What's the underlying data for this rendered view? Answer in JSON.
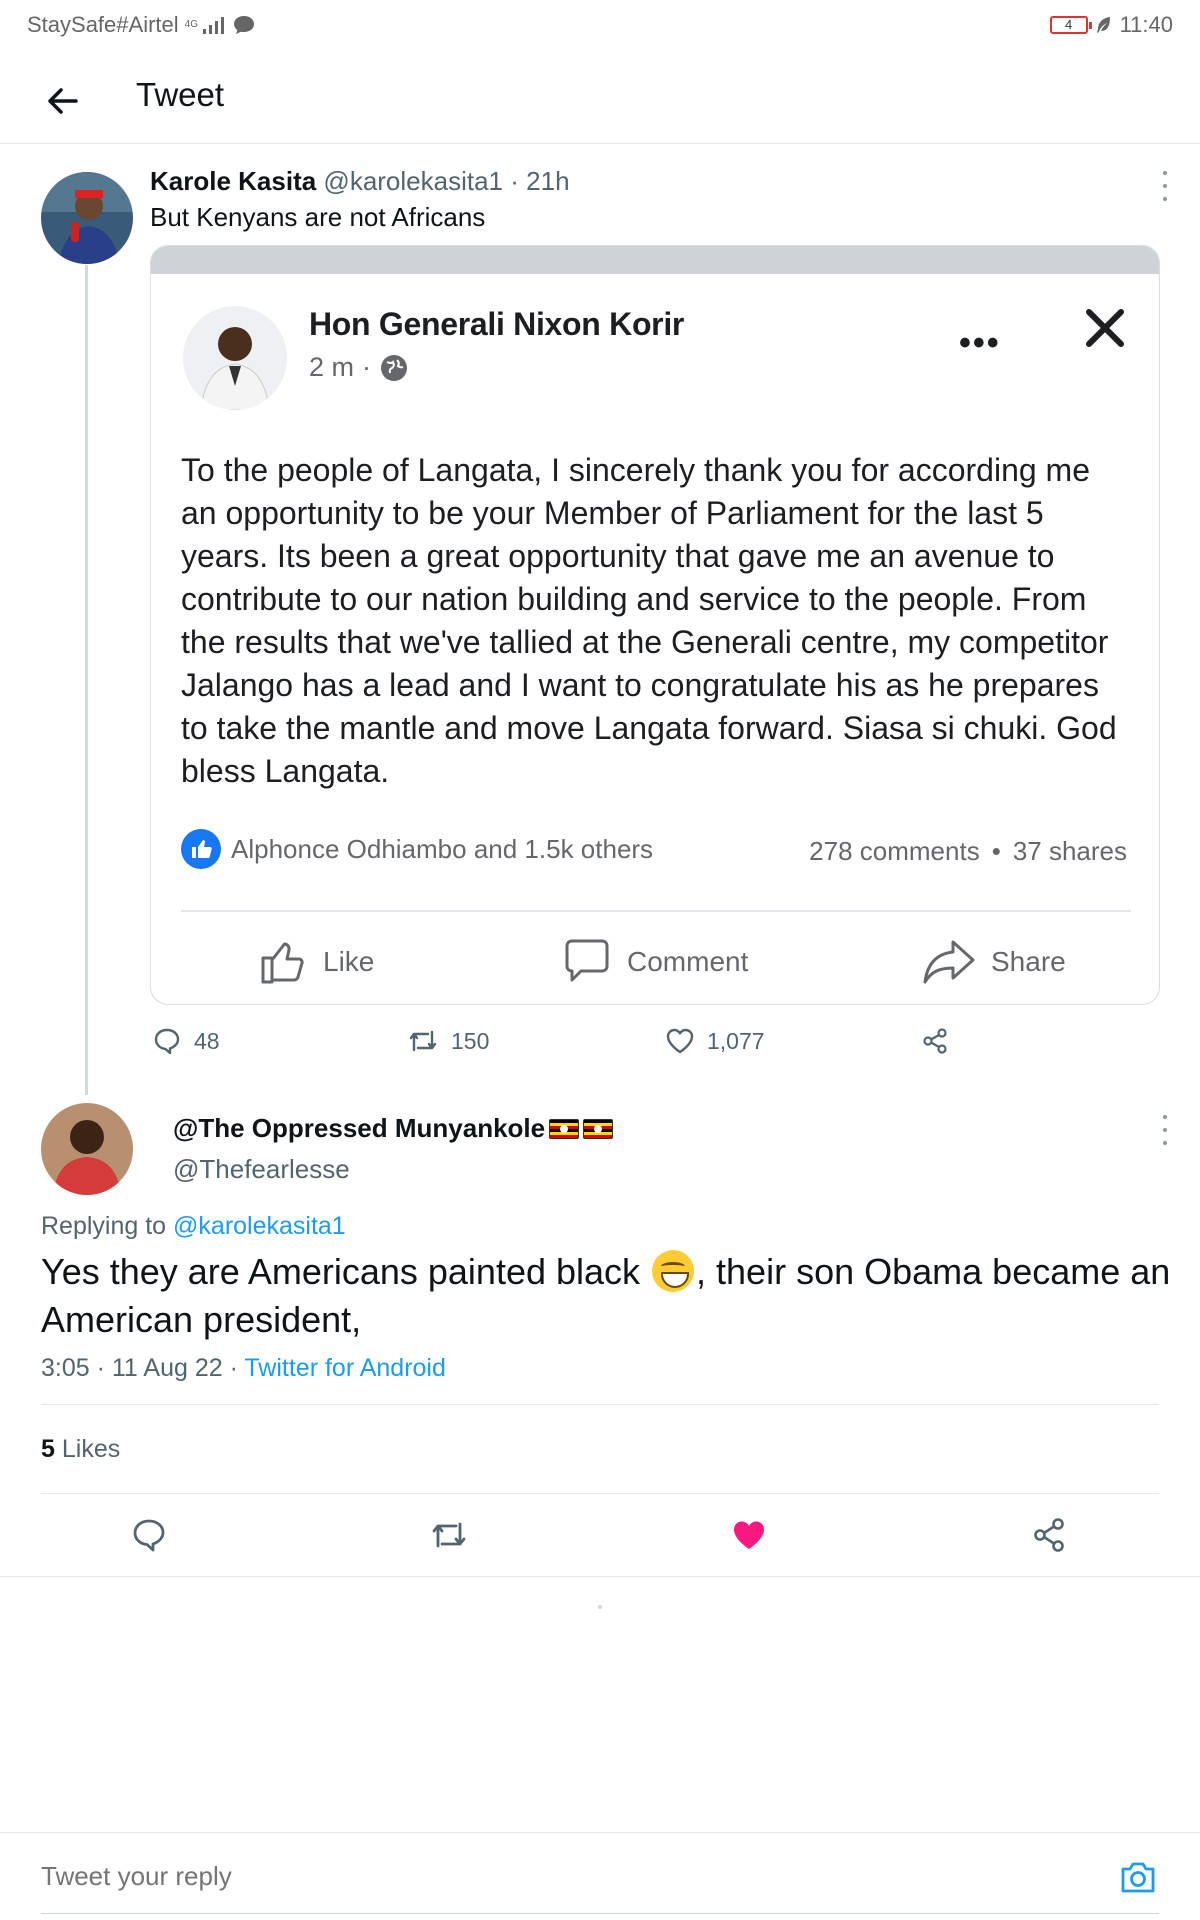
{
  "statusbar": {
    "carrier": "StaySafe#Airtel",
    "network": "4G",
    "battery": "4",
    "time": "11:40"
  },
  "header": {
    "title": "Tweet"
  },
  "tweet1": {
    "name": "Karole Kasita",
    "handle": "@karolekasita1",
    "separator": "·",
    "time": "21h",
    "text": "But Kenyans are not Africans",
    "embed": {
      "fb_name": "Hon Generali Nixon Korir",
      "fb_time": "2 m",
      "fb_dot": "·",
      "fb_more": "•••",
      "fb_post": "To the people of Langata, I  sincerely thank you for according me an opportunity to be your Member of Parliament for the last 5 years. Its been a great opportunity that gave me an avenue to contribute to our nation building and service to the people. From the results that we've tallied at the Generali centre, my competitor Jalango has a lead and I want to congratulate his as he prepares to take the mantle and move Langata forward. Siasa si chuki. God bless Langata.",
      "fb_reactions": "Alphonce Odhiambo and 1.5k others",
      "fb_comments": "278 comments",
      "fb_bullet": "•",
      "fb_shares": "37 shares",
      "fb_like": "Like",
      "fb_comment": "Comment",
      "fb_share": "Share"
    },
    "actions": {
      "replies": "48",
      "retweets": "150",
      "likes": "1,077"
    }
  },
  "tweet2": {
    "name": "@The Oppressed Munyankole",
    "handle": "@Thefearlesse",
    "replying_label": "Replying to",
    "replying_handle": "@karolekasita1",
    "text_before": "Yes they are Americans painted black ",
    "text_after": ", their son Obama became an American president,",
    "timestamp": "3:05 · 11 Aug 22",
    "meta_separator": " · ",
    "source": "Twitter for Android",
    "likes_count": "5",
    "likes_label": "Likes"
  },
  "reply": {
    "placeholder": "Tweet your reply"
  },
  "colors": {
    "twitter_blue": "#1d9bf0",
    "like_pink": "#f91880",
    "fb_blue": "#1877f2"
  }
}
